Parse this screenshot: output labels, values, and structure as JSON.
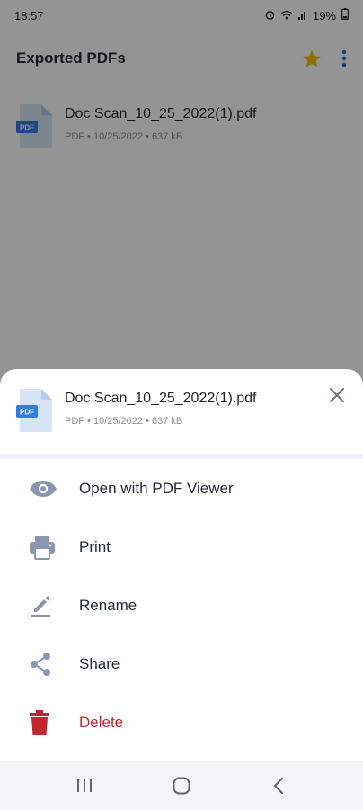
{
  "status_bar": {
    "time": "18:57",
    "battery": "19%",
    "icons": [
      "alarm-icon",
      "wifi-icon",
      "signal-icon",
      "battery-icon"
    ]
  },
  "app_bar": {
    "title": "Exported PDFs",
    "star_color": "#f4c20d",
    "actions": [
      "star-icon",
      "more-vert-icon"
    ]
  },
  "file_list": [
    {
      "name": "Doc Scan_10_25_2022(1).pdf",
      "meta": "PDF • 10/25/2022 • 637 kB",
      "icon": "pdf-file-icon"
    }
  ],
  "sheet": {
    "file_name": "Doc Scan_10_25_2022(1).pdf",
    "file_meta": "PDF • 10/25/2022 • 637 kB",
    "file_icon_label": "PDF",
    "menu": [
      {
        "label": "Open with PDF Viewer",
        "icon": "eye-icon"
      },
      {
        "label": "Print",
        "icon": "printer-icon"
      },
      {
        "label": "Rename",
        "icon": "pencil-icon"
      },
      {
        "label": "Share",
        "icon": "share-icon"
      },
      {
        "label": "Delete",
        "icon": "trash-icon"
      }
    ],
    "icon_color": "#8a97b0",
    "danger_color": "#c4242b"
  },
  "nav_bar": {
    "buttons": [
      "recent-apps-icon",
      "home-icon",
      "back-icon"
    ]
  }
}
